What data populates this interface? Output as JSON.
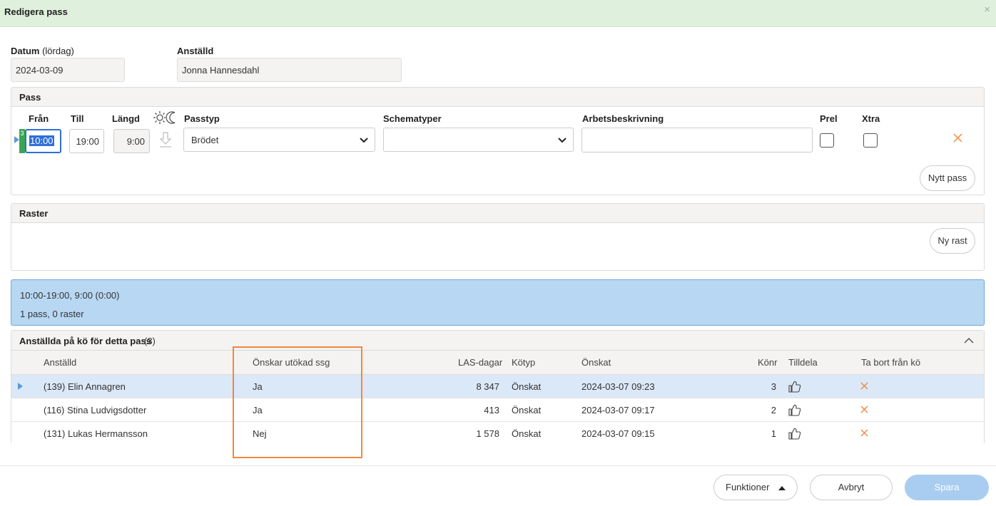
{
  "dialog": {
    "title": "Redigera pass",
    "close_glyph": "×"
  },
  "datum": {
    "label": "Datum",
    "label_suffix": "(lördag)",
    "value": "2024-03-09"
  },
  "anstalld": {
    "label": "Anställd",
    "value": "Jonna Hannesdahl"
  },
  "pass_panel": {
    "title": "Pass",
    "headers": {
      "fran": "Från",
      "till": "Till",
      "langd": "Längd",
      "passtyp": "Passtyp",
      "schematyper": "Schematyper",
      "arbetsbeskrivning": "Arbetsbeskrivning",
      "prel": "Prel",
      "xtra": "Xtra"
    },
    "row": {
      "marker": "3",
      "fran": "10:00",
      "till": "19:00",
      "langd": "9:00",
      "passtyp": "Brödet",
      "schematyper": "",
      "arbetsbeskrivning": "",
      "prel": false,
      "xtra": false
    },
    "nytt_pass": "Nytt pass"
  },
  "raster_panel": {
    "title": "Raster",
    "ny_rast": "Ny rast"
  },
  "summary": {
    "line1": "10:00-19:00, 9:00 (0:00)",
    "line2": "1 pass, 0 raster"
  },
  "queue": {
    "title": "Anställda på kö för detta pass",
    "count": "(3)",
    "columns": {
      "anstalld": "Anställd",
      "onskar": "Önskar utökad ssg",
      "las": "LAS-dagar",
      "kotyp": "Kötyp",
      "onskat": "Önskat",
      "konr": "Könr",
      "tilldela": "Tilldela",
      "ta_bort": "Ta bort från kö"
    },
    "rows": [
      {
        "anstalld": "(139) Elin Annagren",
        "onskar": "Ja",
        "las": "8 347",
        "kotyp": "Önskat",
        "onskat": "2024-03-07 09:23",
        "konr": "3",
        "selected": true
      },
      {
        "anstalld": "(116) Stina Ludvigsdotter",
        "onskar": "Ja",
        "las": "413",
        "kotyp": "Önskat",
        "onskat": "2024-03-07 09:17",
        "konr": "2",
        "selected": false
      },
      {
        "anstalld": "(131) Lukas Hermansson",
        "onskar": "Nej",
        "las": "1 578",
        "kotyp": "Önskat",
        "onskat": "2024-03-07 09:15",
        "konr": "1",
        "selected": false
      }
    ]
  },
  "footer": {
    "funktioner": "Funktioner",
    "avbryt": "Avbryt",
    "spara": "Spara"
  },
  "colors": {
    "accent": "#6fa8dc",
    "primary_button": "#a9cdf0",
    "delete": "#f0883e",
    "header_green": "#dff0dd"
  },
  "icons": {
    "sun": "sun-icon",
    "moon": "moon-icon",
    "copy_down": "arrow-down-icon",
    "remove": "close-icon",
    "assign": "thumbs-up-icon",
    "row_pointer": "caret-right-icon",
    "collapse": "chevron-up-icon"
  }
}
